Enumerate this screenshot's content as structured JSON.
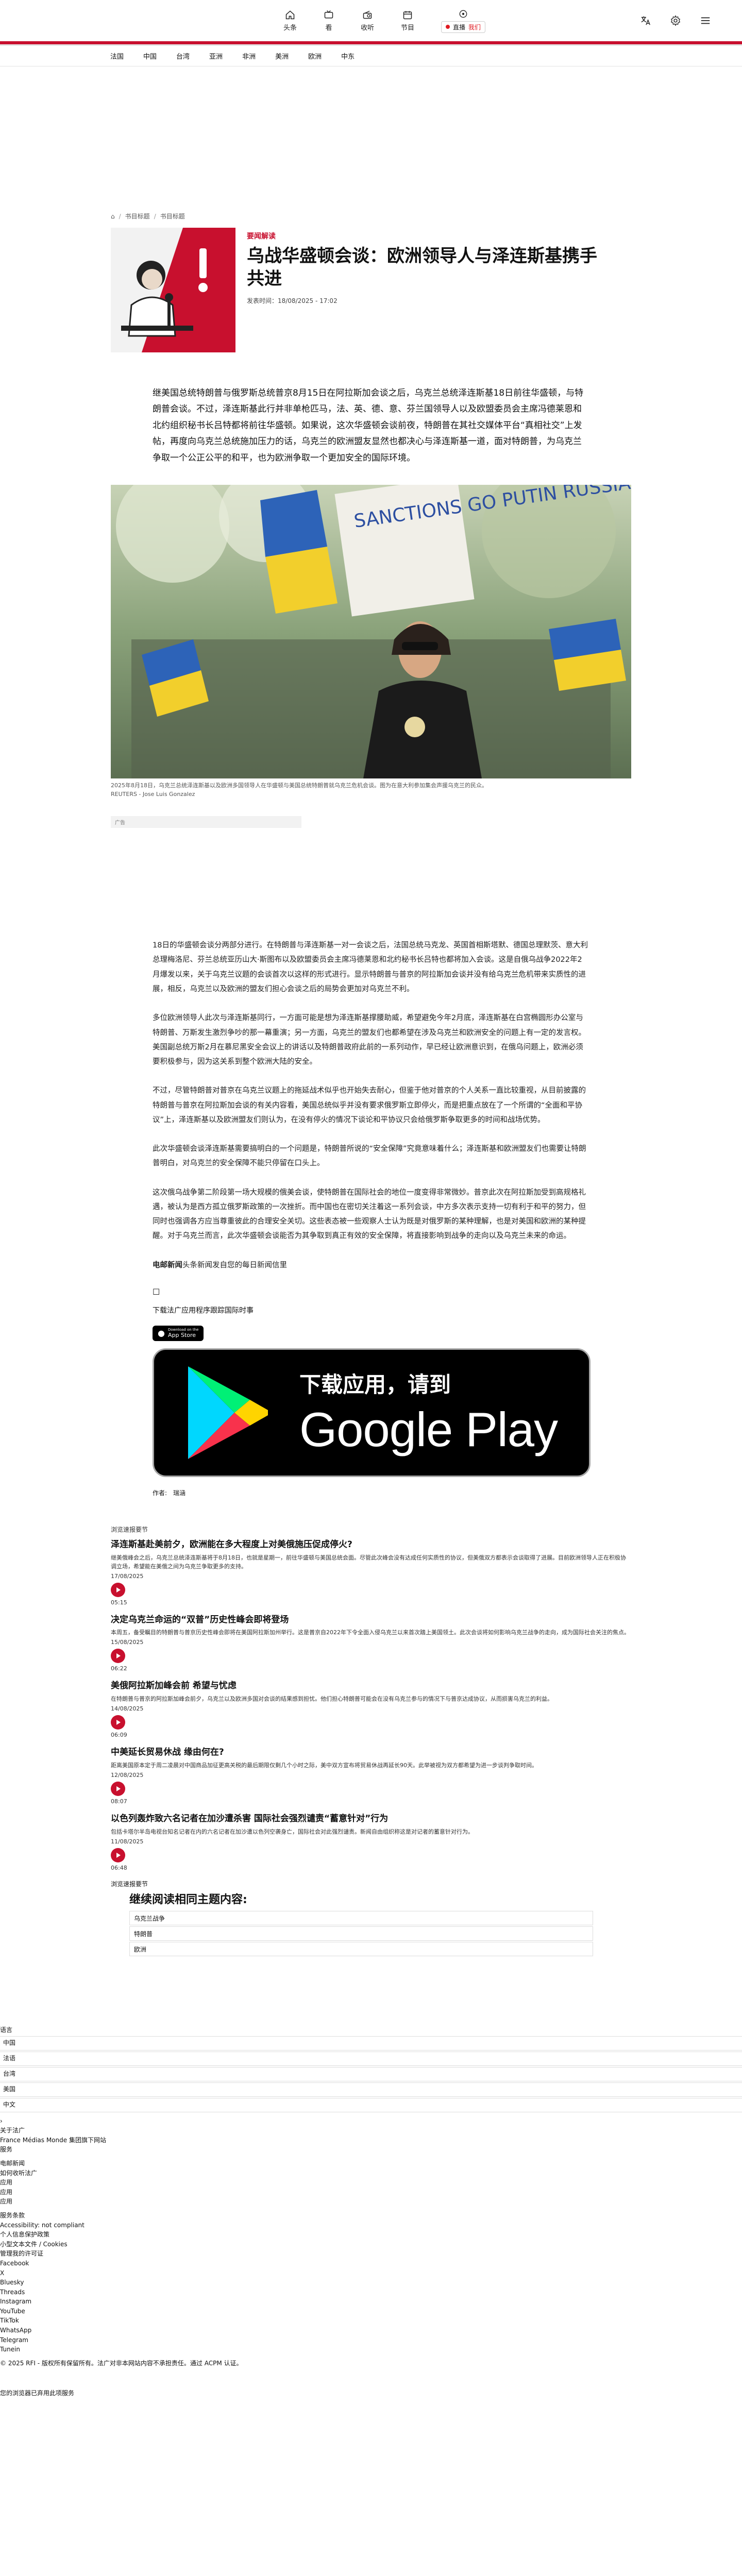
{
  "topbar": {
    "nav": [
      {
        "label": "头条",
        "icon": "home-icon"
      },
      {
        "label": "看",
        "icon": "tv-icon"
      },
      {
        "label": "收听",
        "icon": "radio-icon"
      },
      {
        "label": "节目",
        "icon": "calendar-icon"
      }
    ],
    "live_label": "直播",
    "live_channel": "我们",
    "icons": [
      "translate-icon",
      "settings-icon",
      "menu-icon"
    ],
    "brand_color": "#c8102e"
  },
  "section_nav": [
    "法国",
    "中国",
    "台湾",
    "亚洲",
    "非洲",
    "美洲",
    "欧洲",
    "中东"
  ],
  "breadcrumb": {
    "items": [
      "书目标题",
      "书目标题"
    ]
  },
  "article": {
    "kicker": "要闻解读",
    "title": "乌战华盛顿会谈：欧洲领导人与泽连斯基携手共进",
    "date": "发表时间：18/08/2025 - 17:02",
    "lead": "继美国总统特朗普与俄罗斯总统普京8月15日在阿拉斯加会谈之后，乌克兰总统泽连斯基18日前往华盛顿，与特朗普会谈。不过，泽连斯基此行并非单枪匹马，法、英、德、意、芬兰国领导人以及欧盟委员会主席冯德莱恩和北约组织秘书长吕特都将前往华盛顿。如果说，这次华盛顿会谈前夜，特朗普在其社交媒体平台“真相社交”上发帖，再度向乌克兰总统施加压力的话，乌克兰的欧洲盟友显然也都决心与泽连斯基一道，面对特朗普，为乌克兰争取一个公正公平的和平，也为欧洲争取一个更加安全的国际环境。",
    "photo_caption": "2025年8月18日，乌克兰总统泽连斯基以及欧洲多国领导人在华盛顿与美国总统特朗普就乌克兰危机会谈。图为在意大利参加集会声援乌克兰的民众。",
    "photo_credit": "REUTERS - Jose Luis Gonzalez",
    "photo_sign_text": "SANCTIONS GO PUTIN RUSSIA",
    "ad_label": "广告",
    "paragraphs": [
      "18日的华盛顿会谈分两部分进行。在特朗普与泽连斯基一对一会谈之后，法国总统马克龙、英国首相斯塔默、德国总理默茨、意大利总理梅洛尼、芬兰总统亚历山大·斯图布以及欧盟委员会主席冯德莱恩和北约秘书长吕特也都将加入会谈。这是自俄乌战争2022年2月爆发以来，关于乌克兰议题的会谈首次以这样的形式进行。显示特朗普与普京的阿拉斯加会谈并没有给乌克兰危机带来实质性的进展，相反，乌克兰以及欧洲的盟友们担心会谈之后的局势会更加对乌克兰不利。",
      "多位欧洲领导人此次与泽连斯基同行，一方面可能是想为泽连斯基撑腰助威，希望避免今年2月底，泽连斯基在白宫椭圆形办公室与特朗普、万斯发生激烈争吵的那一幕重演；另一方面，乌克兰的盟友们也都希望在涉及乌克兰和欧洲安全的问题上有一定的发言权。美国副总统万斯2月在慕尼黑安全会议上的讲话以及特朗普政府此前的一系列动作，早已经让欧洲意识到，在俄乌问题上，欧洲必须要积极参与，因为这关系到整个欧洲大陆的安全。",
      "不过，尽管特朗普对普京在乌克兰议题上的拖延战术似乎也开始失去耐心，但鉴于他对普京的个人关系一直比较重视，从目前披露的特朗普与普京在阿拉斯加会谈的有关内容看，美国总统似乎并没有要求俄罗斯立即停火，而是把重点放在了一个所谓的“全面和平协议”上，泽连斯基以及欧洲盟友们则认为，在没有停火的情况下谈论和平协议只会给俄罗斯争取更多的时间和战场优势。",
      "此次华盛顿会谈泽连斯基需要搞明白的一个问题是，特朗普所说的“安全保障”究竟意味着什么；泽连斯基和欧洲盟友们也需要让特朗普明白，对乌克兰的安全保障不能只停留在口头上。",
      "这次俄乌战争第二阶段第一场大规模的俄美会谈，使特朗普在国际社会的地位一度变得非常微妙。普京此次在阿拉斯加受到高规格礼遇，被认为是西方孤立俄罗斯政策的一次挫折。而中国也在密切关注着这一系列会谈，中方多次表示支持一切有利于和平的努力，但同时也强调各方应当尊重彼此的合理安全关切。这些表态被一些观察人士认为既是对俄罗斯的某种理解，也是对美国和欧洲的某种提醒。对于乌克兰而言，此次华盛顿会谈能否为其争取到真正有效的安全保障，将直接影响到战争的走向以及乌克兰未来的命运。"
    ],
    "source_bold": "电邮新闻",
    "source_text": "头条新闻发自您的每日新闻信里",
    "download_text": "下载法广应用程序跟踪国际时事",
    "appstore_small": "Download on the",
    "appstore_big": "App Store",
    "gplay_line1": "下载应用，请到",
    "gplay_line2": "Google Play",
    "author": "作者:　瑞涵"
  },
  "feed": {
    "heading": "浏览速报要节",
    "items": [
      {
        "title": "泽连斯基赴美前夕，欧洲能在多大程度上对美俄施压促成停火?",
        "desc": "继美俄峰会之后，乌克兰总统泽连斯基将于8月18日，也就是星期一，前往华盛顿与美国总统会面。尽管此次峰会没有达成任何实质性的协议，但美俄双方都表示会谈取得了进展。目前欧洲领导人正在积极协调立场，希望能在美俄之间为乌克兰争取更多的支持。",
        "date": "17/08/2025",
        "time": "05:15"
      },
      {
        "title": "决定乌克兰命运的“双普”历史性峰会即将登场",
        "desc": "本周五，备受瞩目的特朗普与普京历史性峰会即将在美国阿拉斯加州举行。这是普京自2022年下令全面入侵乌克兰以来首次踏上美国领土。此次会谈将如何影响乌克兰战争的走向，成为国际社会关注的焦点。",
        "date": "15/08/2025",
        "time": "06:22"
      },
      {
        "title": "美俄阿拉斯加峰会前 希望与忧虑",
        "desc": "在特朗普与普京的阿拉斯加峰会前夕，乌克兰以及欧洲多国对会谈的结果感到担忧。他们担心特朗普可能会在没有乌克兰参与的情况下与普京达成协议，从而损害乌克兰的利益。",
        "date": "14/08/2025",
        "time": "06:09"
      },
      {
        "title": "中美延长贸易休战 缘由何在?",
        "desc": "距离美国原本定于周二凌晨对中国商品加征更高关税的最后期限仅剩几个小时之际，美中双方宣布将贸易休战再延长90天。此举被视为双方都希望为进一步谈判争取时间。",
        "date": "12/08/2025",
        "time": "08:07"
      },
      {
        "title": "以色列轰炸致六名记者在加沙遭杀害 国际社会强烈谴责“蓄意针对”行为",
        "desc": "包括卡塔尔半岛电视台知名记者在内的六名记者在加沙遭以色列空袭身亡，国际社会对此强烈谴责。新闻自由组织称这是对记者的蓄意针对行为。",
        "date": "11/08/2025",
        "time": "06:48"
      }
    ]
  },
  "more": {
    "label": "浏览速报要节",
    "title": "继续阅读相同主题内容:",
    "topics": [
      "乌克兰战争",
      "特朗普",
      "欧洲"
    ]
  },
  "footer": {
    "lang_label": "语言",
    "options": [
      "中国",
      "法语",
      "台湾",
      "美国",
      "中文"
    ],
    "lines_a": [
      "关于法广",
      "France Médias Monde 集团旗下网站",
      "服务"
    ],
    "lines_b": [
      "电邮新闻",
      "如何收听法广",
      "应用",
      "应用",
      "应用"
    ],
    "lines_c": [
      "服务条款",
      "Accessibility: not compliant",
      "个人信息保护政策",
      "小型文本文件 / Cookies",
      "管理我的许可证",
      "Facebook",
      "X",
      "Bluesky",
      "Threads",
      "Instagram",
      "YouTube",
      "TikTok",
      "WhatsApp",
      "Telegram",
      "Tunein"
    ],
    "copyright": "© 2025 RFI - 版权所有保留所有。法广对非本网站内容不承担责任。通过 ACPM 认证。",
    "note": "您的浏览器已弃用此项服务"
  }
}
